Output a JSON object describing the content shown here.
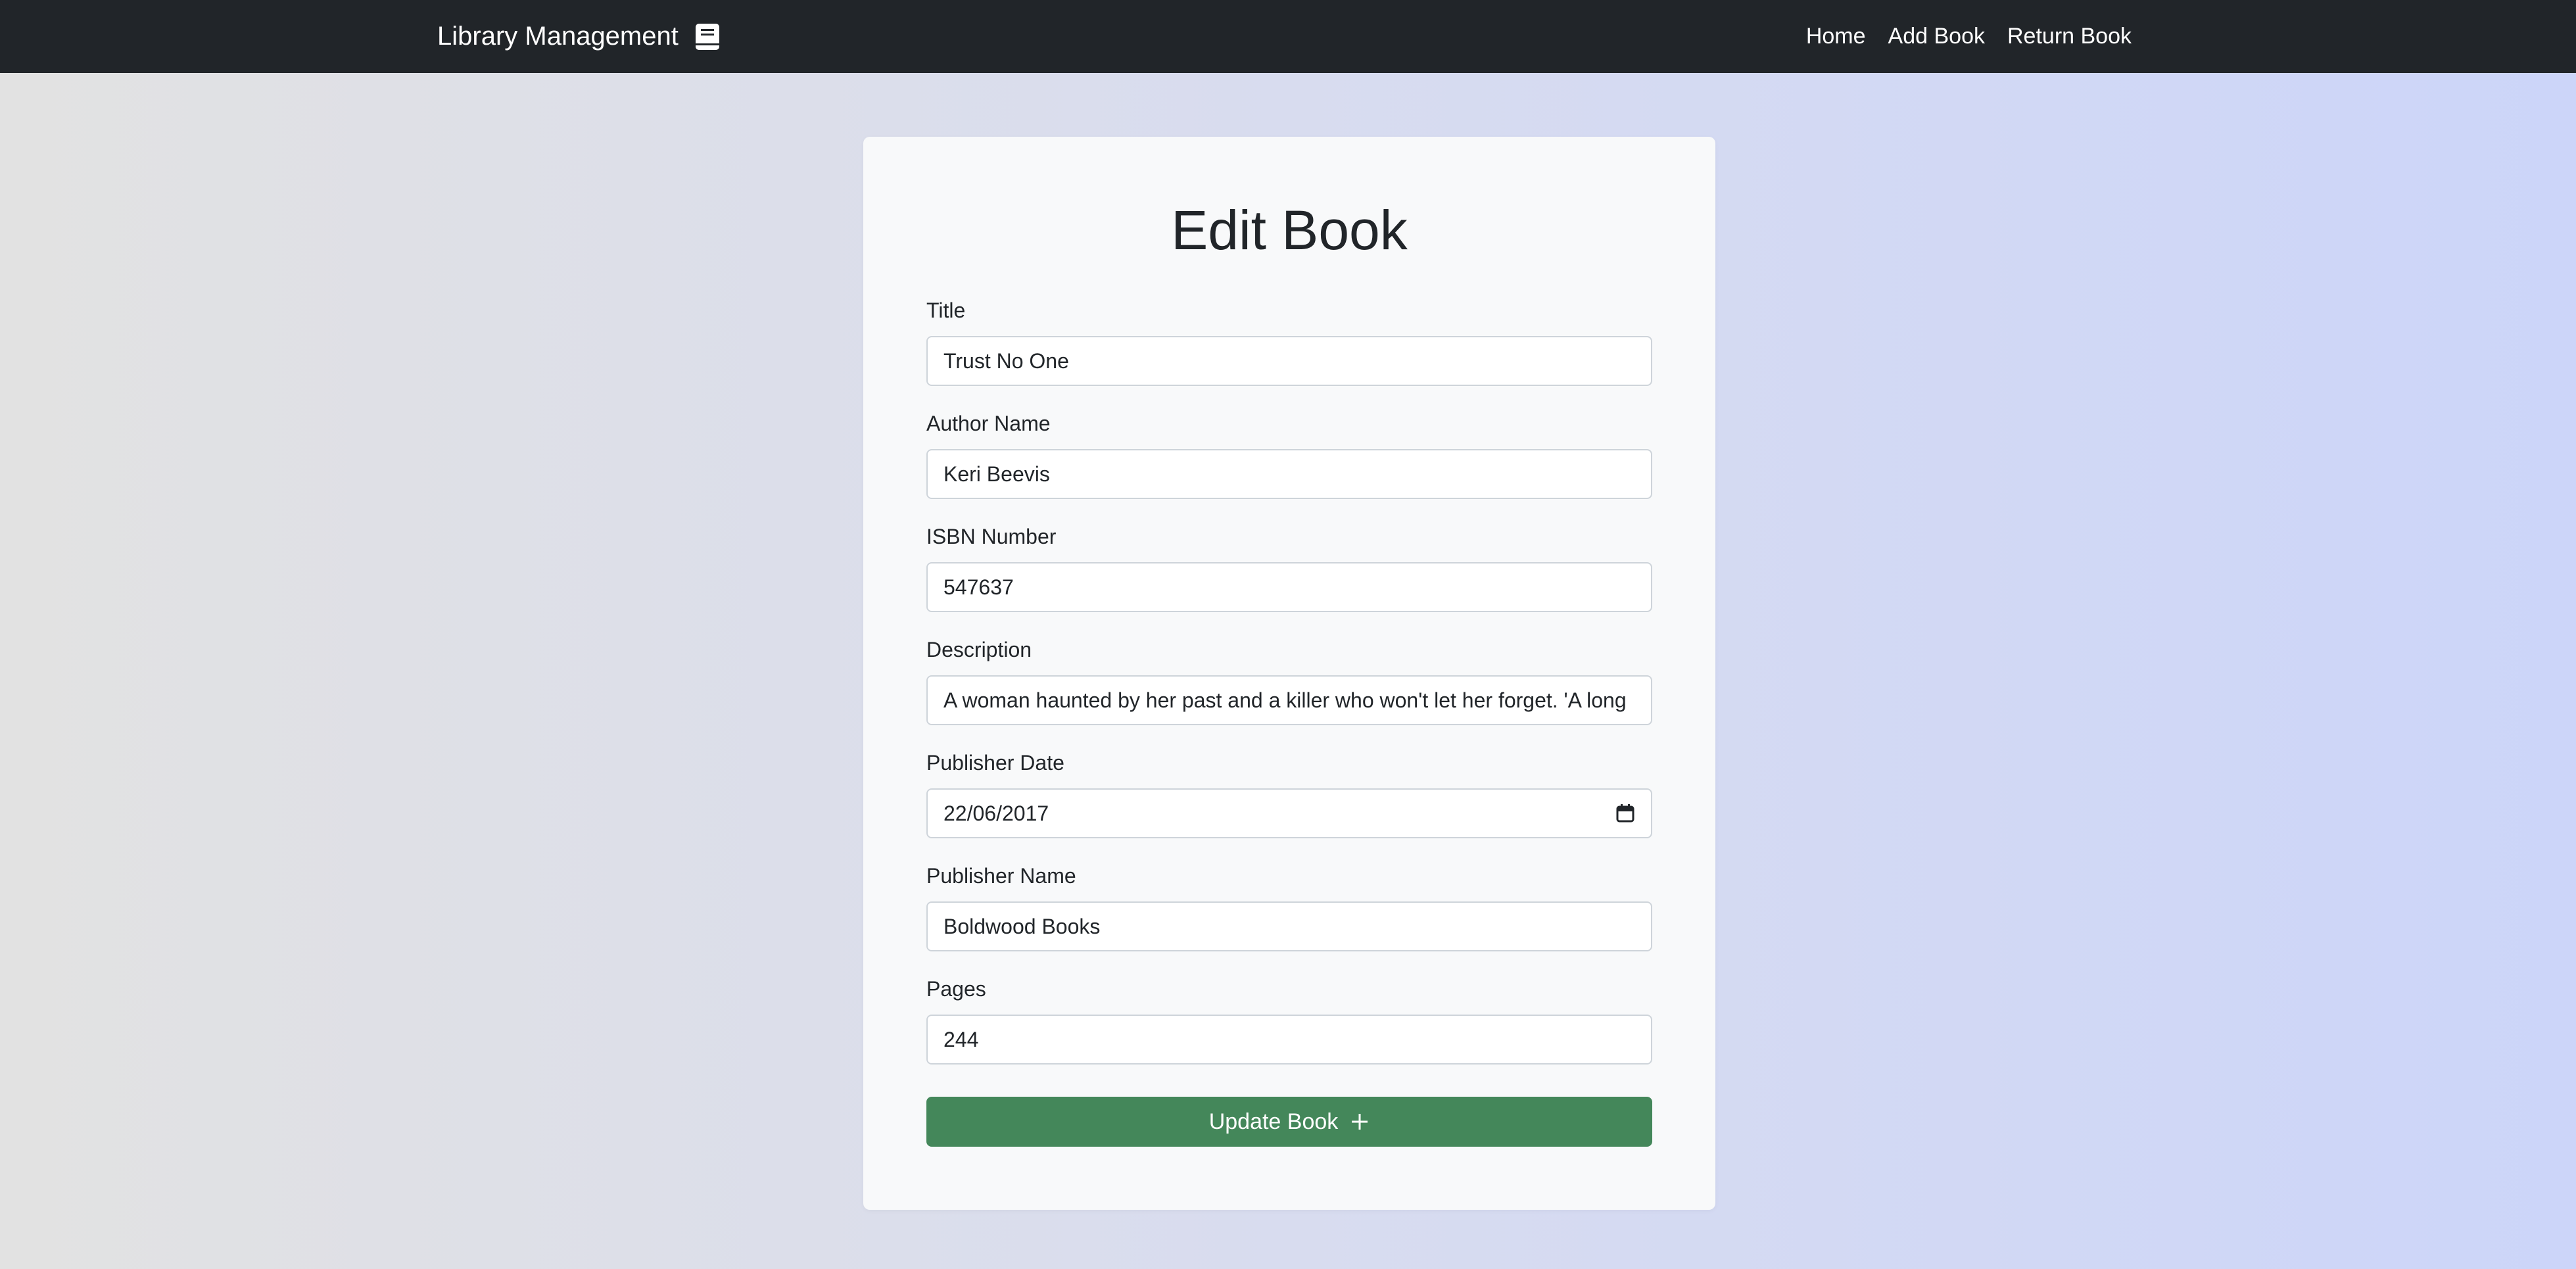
{
  "navbar": {
    "brand": "Library Management",
    "brand_icon": "book-icon",
    "links": [
      {
        "label": "Home"
      },
      {
        "label": "Add Book"
      },
      {
        "label": "Return Book"
      }
    ]
  },
  "form": {
    "title": "Edit Book",
    "fields": [
      {
        "label": "Title",
        "value": "Trust No One"
      },
      {
        "label": "Author Name",
        "value": "Keri Beevis"
      },
      {
        "label": "ISBN Number",
        "value": "547637"
      },
      {
        "label": "Description",
        "value": "A woman haunted by her past and a killer who won't let her forget. 'A long"
      },
      {
        "label": "Publisher Date",
        "value": "22/06/2017",
        "icon": "calendar-icon"
      },
      {
        "label": "Publisher Name",
        "value": "Boldwood Books"
      },
      {
        "label": "Pages",
        "value": "244"
      }
    ],
    "submit_label": "Update Book",
    "submit_icon": "plus-icon"
  },
  "colors": {
    "navbar_bg": "#212529",
    "card_bg": "#f8f9fa",
    "button_bg": "#44875a"
  }
}
